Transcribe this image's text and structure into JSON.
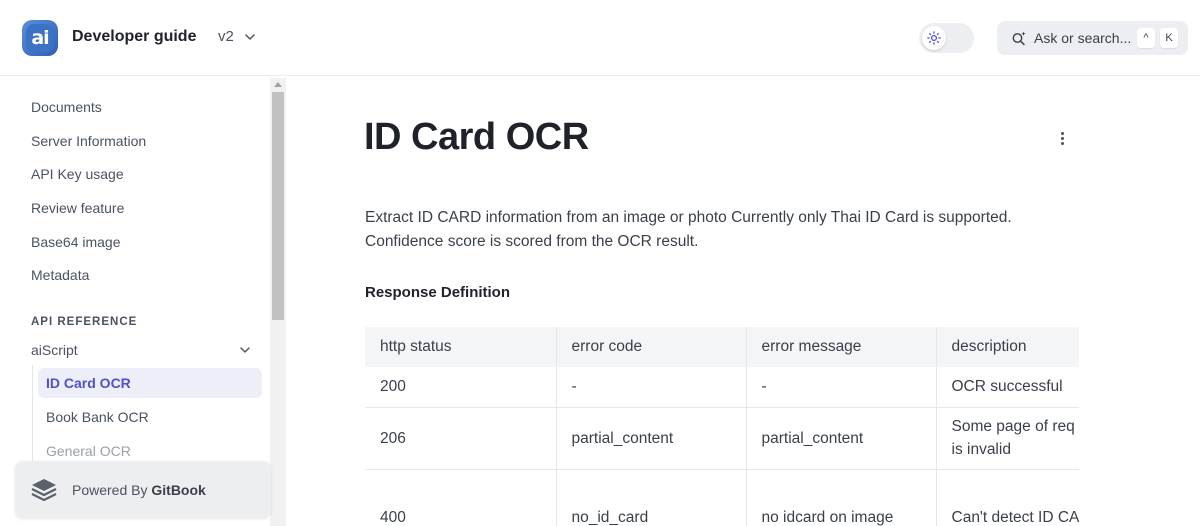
{
  "header": {
    "logo_text": "ai",
    "title": "Developer guide",
    "version": "v2",
    "search_placeholder": "Ask or search...",
    "shortcut_keys": [
      "^",
      "K"
    ]
  },
  "sidebar": {
    "items": [
      "Documents",
      "Server Information",
      "API Key usage",
      "Review feature",
      "Base64 image",
      "Metadata"
    ],
    "section_title": "API REFERENCE",
    "group": "aiScript",
    "sub_items": [
      "ID Card OCR",
      "Book Bank OCR",
      "General OCR"
    ],
    "active_sub_item": "ID Card OCR",
    "powered_prefix": "Powered By ",
    "powered_brand": "GitBook"
  },
  "main": {
    "title": "ID Card OCR",
    "description": "Extract ID CARD information from an image or photo Currently only Thai ID Card is supported. Confidence score is scored from the OCR result.",
    "subheading": "Response Definition",
    "table": {
      "headers": [
        "http status",
        "error code",
        "error message",
        "description"
      ],
      "rows": [
        [
          "200",
          "-",
          "-",
          "OCR successful"
        ],
        [
          "206",
          "partial_content",
          "partial_content",
          "Some page of req is invalid"
        ],
        [
          "400",
          "no_id_card",
          "no idcard on image",
          "Can't detect ID CA"
        ]
      ]
    }
  },
  "colors": {
    "accent": "#4e51c8",
    "active_bg": "#eeeef9",
    "logo": "#3c72c6"
  }
}
